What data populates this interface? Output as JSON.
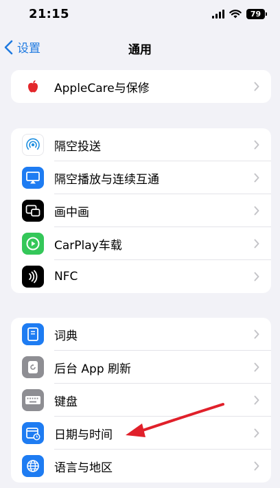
{
  "status": {
    "time": "21:15",
    "battery": "79"
  },
  "nav": {
    "back_label": "设置",
    "title": "通用"
  },
  "groups": [
    {
      "items": [
        {
          "label": "AppleCare与保修",
          "icon": "apple-logo-icon"
        }
      ]
    },
    {
      "items": [
        {
          "label": "隔空投送",
          "icon": "airdrop-icon"
        },
        {
          "label": "隔空播放与连续互通",
          "icon": "airplay-icon"
        },
        {
          "label": "画中画",
          "icon": "picture-in-picture-icon"
        },
        {
          "label": "CarPlay车载",
          "icon": "carplay-icon"
        },
        {
          "label": "NFC",
          "icon": "nfc-icon"
        }
      ]
    },
    {
      "items": [
        {
          "label": "词典",
          "icon": "dictionary-icon"
        },
        {
          "label": "后台 App 刷新",
          "icon": "background-refresh-icon"
        },
        {
          "label": "键盘",
          "icon": "keyboard-icon"
        },
        {
          "label": "日期与时间",
          "icon": "date-time-icon"
        },
        {
          "label": "语言与地区",
          "icon": "globe-icon"
        }
      ]
    }
  ],
  "colors": {
    "accent": "#1f7ae0",
    "annotation_arrow": "#e0202a"
  }
}
